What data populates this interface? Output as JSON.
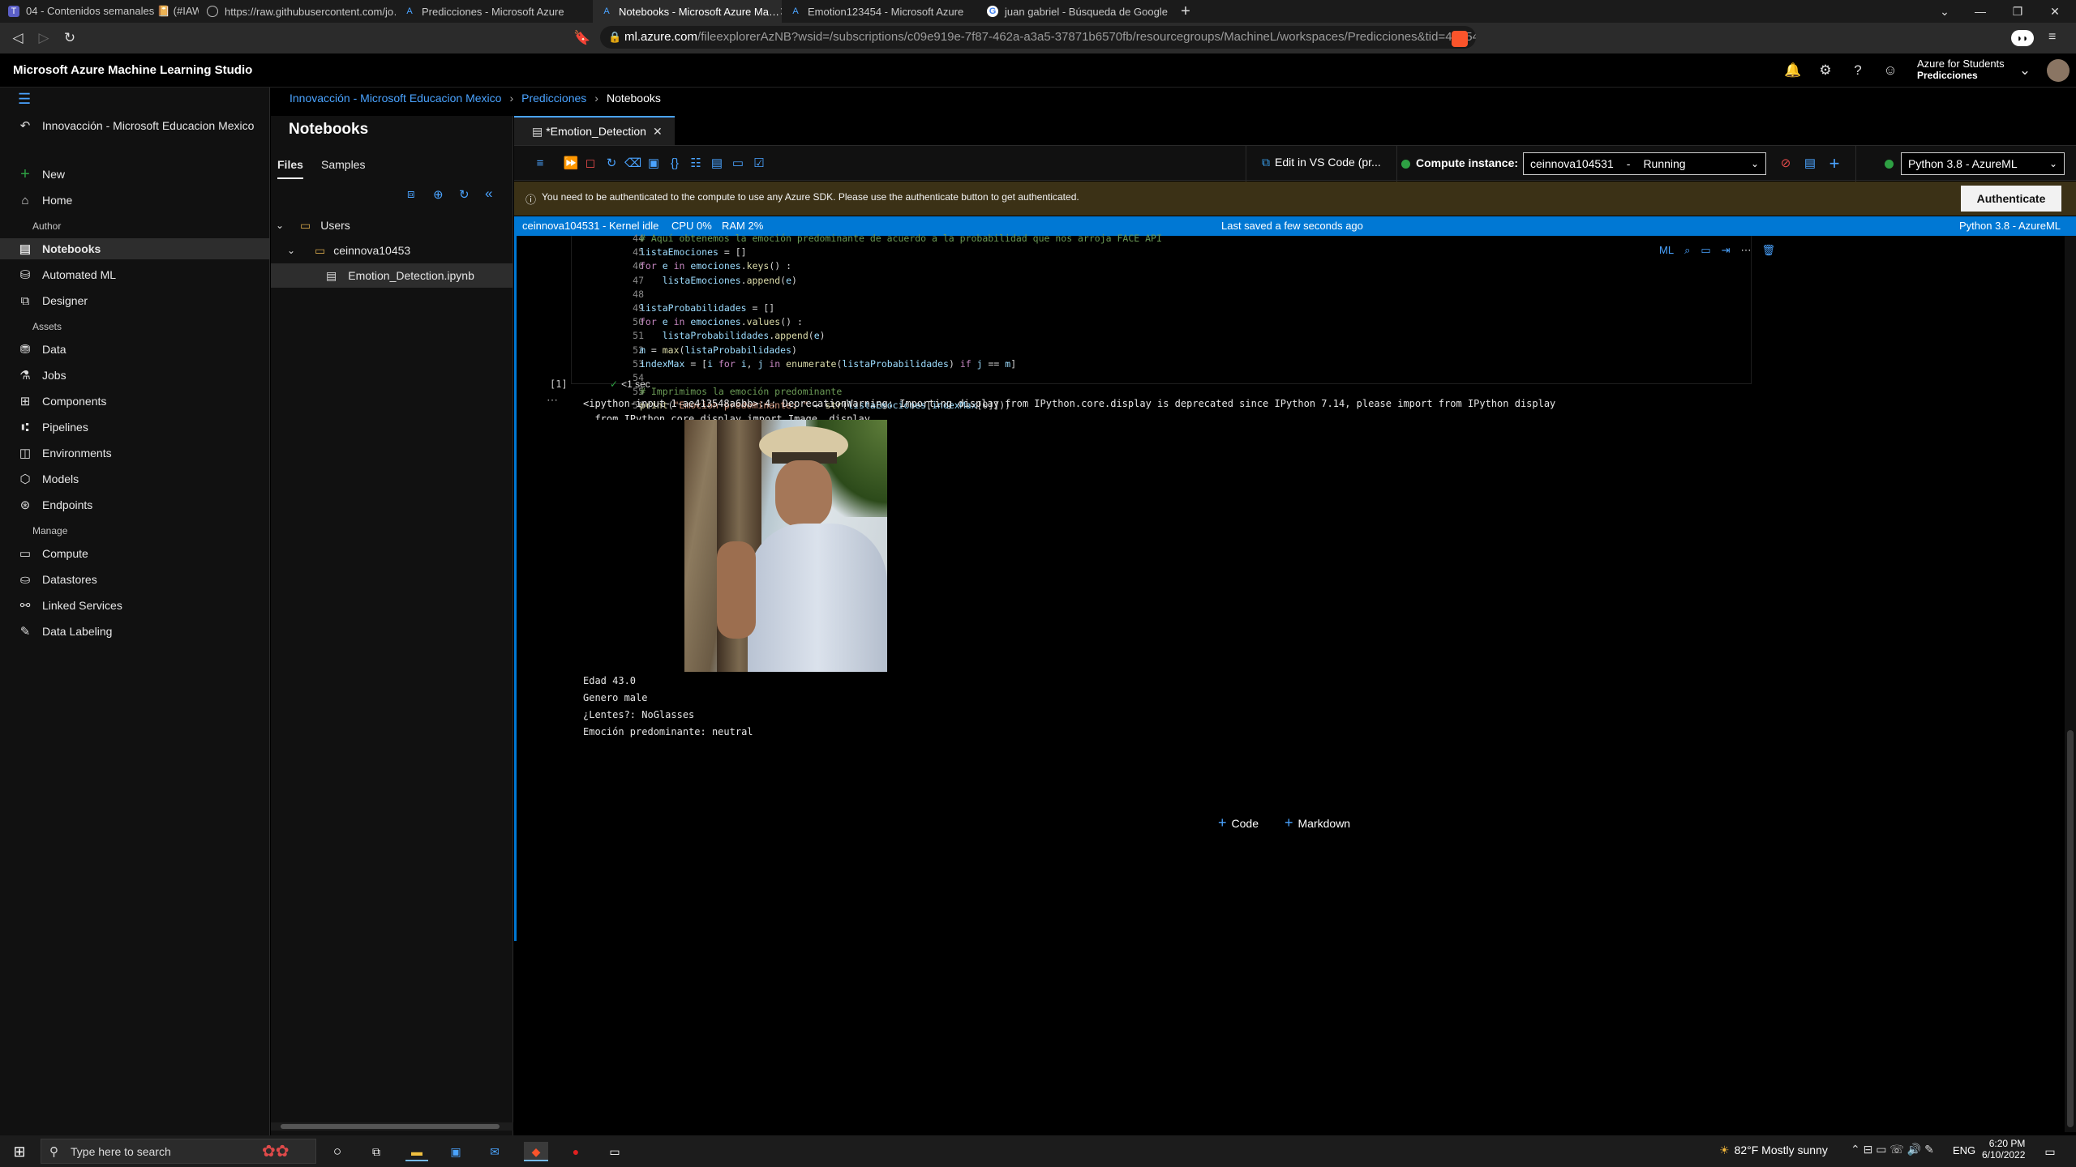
{
  "browser": {
    "tabs": [
      {
        "label": "04 - Contenidos semanales 📔 (#IAW…",
        "icon": "teams-icon"
      },
      {
        "label": "https://raw.githubusercontent.com/jo…",
        "icon": "globe-icon"
      },
      {
        "label": "Predicciones - Microsoft Azure",
        "icon": "azure-icon"
      },
      {
        "label": "Notebooks - Microsoft Azure Ma…",
        "icon": "azure-icon"
      },
      {
        "label": "Emotion123454 - Microsoft Azure",
        "icon": "azure-icon"
      },
      {
        "label": "juan gabriel - Búsqueda de Google",
        "icon": "google-icon"
      }
    ],
    "url_host": "ml.azure.com",
    "url_path": "/fileexplorerAzNB?wsid=/subscriptions/c09e919e-7f87-462a-a3a5-37871b6570fb/resourcegroups/MachineL/workspaces/Predicciones&tid=4ae54b..."
  },
  "app": {
    "title": "Microsoft Azure Machine Learning Studio",
    "account_line1": "Azure for Students",
    "account_line2": "Predicciones"
  },
  "leftnav": {
    "workspace": "Innovacción - Microsoft Educacion Mexico",
    "new": "New",
    "home": "Home",
    "author_section": "Author",
    "notebooks": "Notebooks",
    "automated_ml": "Automated ML",
    "designer": "Designer",
    "assets_section": "Assets",
    "data": "Data",
    "jobs": "Jobs",
    "components": "Components",
    "pipelines": "Pipelines",
    "environments": "Environments",
    "models": "Models",
    "endpoints": "Endpoints",
    "manage_section": "Manage",
    "compute": "Compute",
    "datastores": "Datastores",
    "linked_services": "Linked Services",
    "data_labeling": "Data Labeling"
  },
  "breadcrumb": {
    "item1": "Innovacción - Microsoft Educacion Mexico",
    "item2": "Predicciones",
    "current": "Notebooks"
  },
  "filepanel": {
    "title": "Notebooks",
    "tab_files": "Files",
    "tab_samples": "Samples",
    "tree_users": "Users",
    "tree_folder": "ceinnova10453",
    "tree_file": "Emotion_Detection.ipynb"
  },
  "editor": {
    "doc_tab": "*Emotion_Detection",
    "edit_in_vscode": "Edit in VS Code (pr...",
    "compute_label": "Compute instance:",
    "compute_value": "ceinnova104531",
    "compute_state": "Running",
    "kernel_value": "Python 3.8 - AzureML",
    "auth_message": "You need to be authenticated to the compute to use any Azure SDK. Please use the authenticate button to get authenticated.",
    "auth_button": "Authenticate",
    "status_left": "ceinnova104531 - Kernel idle",
    "status_cpu": "CPU  0%",
    "status_ram": "RAM  2%",
    "status_saved": "Last saved a few seconds ago",
    "status_kernel": "Python 3.8 - AzureML",
    "exec_count": "[1]",
    "exec_time": "<1 sec",
    "output_warning": "<ipython-input-1-ae413548a6bb>:4: DeprecationWarning: Importing display from IPython.core.display is deprecated since IPython 7.14, please import from IPython display",
    "output_warning2": "  from IPython.core.display import Image, display",
    "out_edad": "Edad 43.0",
    "out_genero": "Genero male",
    "out_lentes": "¿Lentes?: NoGlasses",
    "out_emocion": "Emoción predominante: neutral",
    "add_code": "Code",
    "add_markdown": "Markdown"
  },
  "code_lines": [
    {
      "n": "44",
      "t": "# Aquí obtenemos la emoción predominante de acuerdo a la probabilidad que nos arroja FACE API"
    },
    {
      "n": "45",
      "t": "listaEmociones = []"
    },
    {
      "n": "46",
      "t": "for e in emociones.keys() :"
    },
    {
      "n": "47",
      "t": "    listaEmociones.append(e)"
    },
    {
      "n": "48",
      "t": ""
    },
    {
      "n": "49",
      "t": "listaProbabilidades = []"
    },
    {
      "n": "50",
      "t": "for e in emociones.values() :"
    },
    {
      "n": "51",
      "t": "    listaProbabilidades.append(e)"
    },
    {
      "n": "52",
      "t": "m = max(listaProbabilidades)"
    },
    {
      "n": "53",
      "t": "indexMax = [i for i, j in enumerate(listaProbabilidades) if j == m]"
    },
    {
      "n": "54",
      "t": ""
    },
    {
      "n": "55",
      "t": "# Imprimimos la emoción predominante"
    },
    {
      "n": "56",
      "t": "print(\"Emoción predominante: \" + str(listaEmociones[indexMax[0]]))"
    }
  ],
  "taskbar": {
    "search_placeholder": "Type here to search",
    "weather": "82°F  Mostly sunny",
    "lang": "ENG",
    "time": "6:20 PM",
    "date": "6/10/2022"
  },
  "colors": {
    "accent": "#0078d4",
    "link": "#4aa3ff",
    "warning_bar": "#3b3116",
    "running": "#2ea043"
  }
}
